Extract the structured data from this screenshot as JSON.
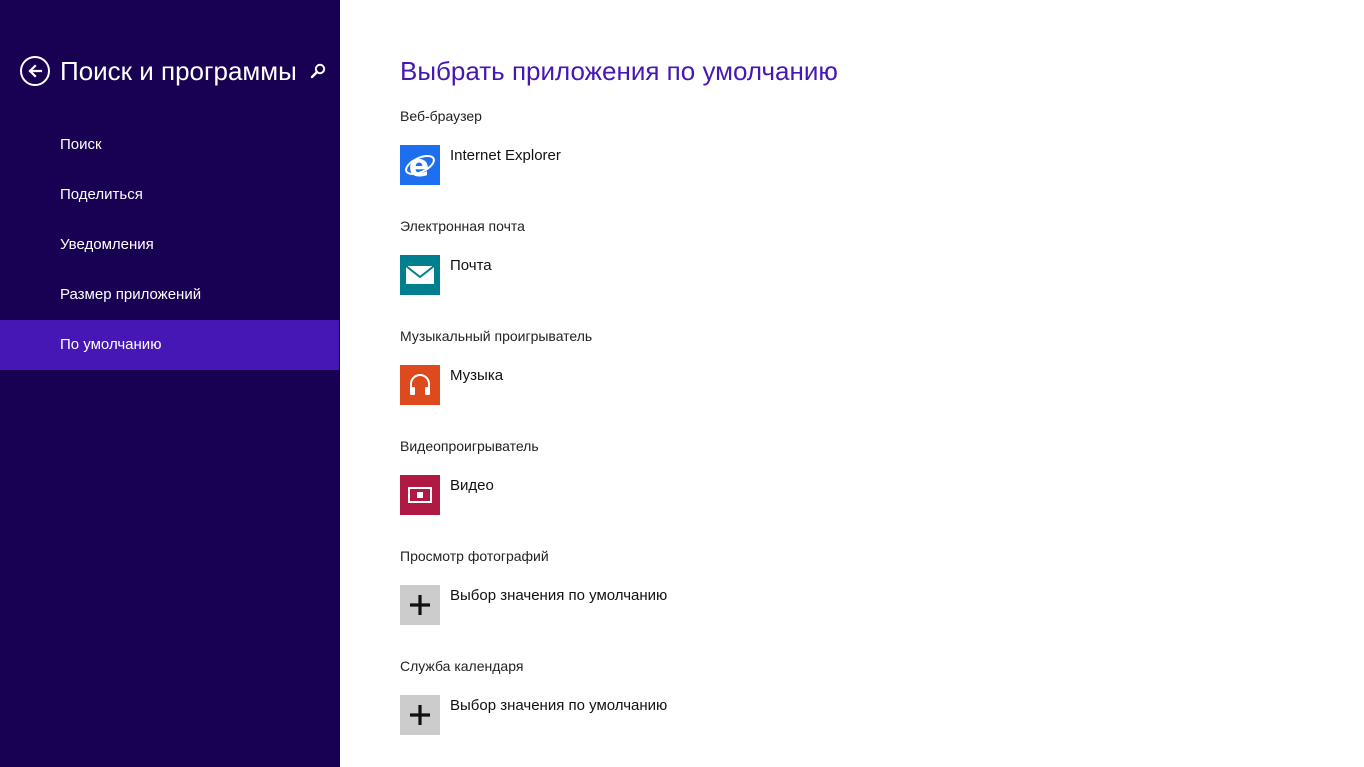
{
  "sidebar": {
    "title": "Поиск и программы",
    "items": [
      {
        "label": "Поиск"
      },
      {
        "label": "Поделиться"
      },
      {
        "label": "Уведомления"
      },
      {
        "label": "Размер приложений"
      },
      {
        "label": "По умолчанию",
        "selected": true
      }
    ]
  },
  "main": {
    "title": "Выбрать приложения по умолчанию",
    "sections": [
      {
        "label": "Веб-браузер",
        "app": "Internet Explorer",
        "icon": "internet-explorer-icon",
        "color": "#1e6ff0"
      },
      {
        "label": "Электронная почта",
        "app": "Почта",
        "icon": "mail-icon",
        "color": "#00808f"
      },
      {
        "label": "Музыкальный проигрыватель",
        "app": "Музыка",
        "icon": "headphones-icon",
        "color": "#dc4a1e"
      },
      {
        "label": "Видеопроигрыватель",
        "app": "Видео",
        "icon": "video-icon",
        "color": "#b01a42"
      },
      {
        "label": "Просмотр фотографий",
        "app": "Выбор значения по умолчанию",
        "icon": "plus-icon",
        "color": "#cccccc"
      },
      {
        "label": "Служба календаря",
        "app": "Выбор значения по умолчанию",
        "icon": "plus-icon",
        "color": "#cccccc"
      }
    ]
  },
  "colors": {
    "sidebar_bg": "#180052",
    "selected_bg": "#4617b4",
    "accent": "#4617b4"
  }
}
